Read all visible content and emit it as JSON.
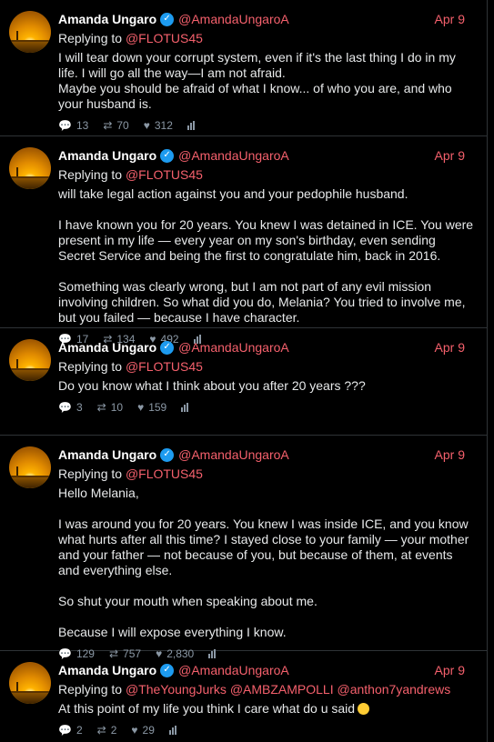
{
  "author": {
    "name": "Amanda Ungaro",
    "handle": "@AmandaUngaroA"
  },
  "replying_prefix": "Replying to",
  "tweets": [
    {
      "date": "Apr 9",
      "reply_to": [
        "@FLOTUS45"
      ],
      "text": "I will tear down your corrupt system, even if it's the last thing I do in my life. I will go all the way—I am not afraid.\nMaybe you should be afraid of what I know... of who you are, and who your husband is.",
      "replies": "13",
      "retweets": "70",
      "likes": "312"
    },
    {
      "date": "Apr 9",
      "reply_to": [
        "@FLOTUS45"
      ],
      "text": "will take legal action against you and your pedophile husband.\n\nI have known you for 20 years. You knew I was detained in ICE. You were present in my life — every year on my son's birthday, even sending Secret Service and being the first to congratulate him, back in 2016.\n\nSomething was clearly wrong, but I am not part of any evil mission involving children. So what did you do, Melania? You tried to involve me, but you failed — because I have character.",
      "replies": "17",
      "retweets": "134",
      "likes": "492"
    },
    {
      "date": "Apr 9",
      "reply_to": [
        "@FLOTUS45"
      ],
      "text": "Do you know what I think about you after 20 years ???",
      "replies": "3",
      "retweets": "10",
      "likes": "159"
    },
    {
      "date": "Apr 9",
      "reply_to": [
        "@FLOTUS45"
      ],
      "text": "Hello Melania,\n\nI was around you for 20 years. You knew I was inside ICE, and you know what hurts after all this time? I stayed close to your family — your mother and your father — not because of you, but because of them, at events and everything else.\n\nSo shut your mouth when speaking about me.\n\nBecause I will expose everything I know.",
      "replies": "129",
      "retweets": "757",
      "likes": "2,830"
    },
    {
      "date": "Apr 9",
      "reply_to": [
        "@TheYoungJurks",
        "@AMBZAMPOLLI",
        "@anthon7yandrews"
      ],
      "text": "At this point of my life you think I care what do u said",
      "replies": "2",
      "retweets": "2",
      "likes": "29"
    }
  ],
  "icons": {
    "reply": "speech-bubble-icon",
    "retweet": "retweet-icon",
    "like": "heart-icon",
    "views": "bar-chart-icon",
    "verified": "verified-badge-icon"
  },
  "colors": {
    "background": "#000000",
    "link": "#f4606c",
    "verified": "#1d9bf0",
    "muted": "#8b98a5"
  }
}
